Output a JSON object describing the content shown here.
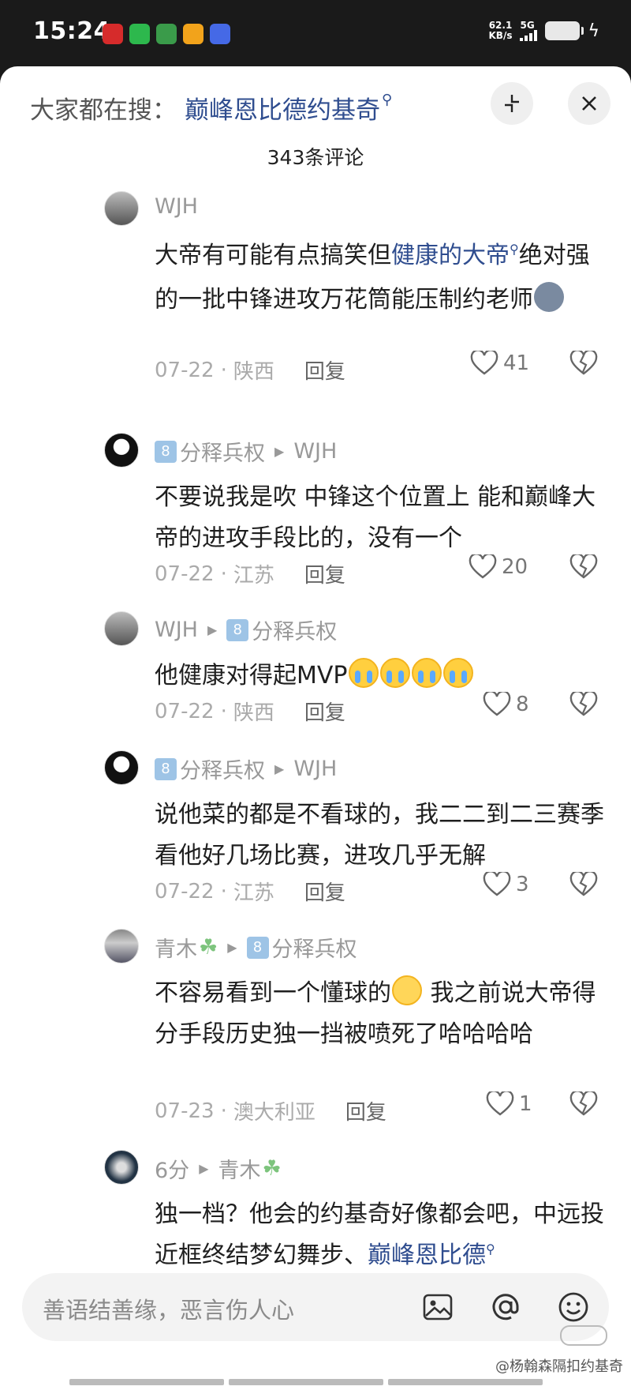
{
  "status_bar": {
    "time": "15:24",
    "net_speed_value": "62.1",
    "net_speed_unit": "KB/s",
    "network": "5G",
    "apps": [
      "app-icon-red",
      "wechat-icon",
      "video-icon",
      "orange-app-icon",
      "vivo-icon"
    ]
  },
  "header": {
    "search_prefix": "大家都在搜：",
    "search_keyword": "巅峰恩比德约基奇",
    "comment_count": "343条评论"
  },
  "comments": [
    {
      "user": "WJH",
      "text_pre": "大帝有可能有点搞笑但",
      "link": "健康的大帝",
      "text_post": "绝对强的一批中锋进攻万花筒能压制约老师",
      "date": "07-22",
      "region": "陕西",
      "reply": "回复",
      "likes": "41"
    },
    {
      "badge": "8",
      "user": "分释兵权",
      "reply_to": "WJH",
      "text": "不要说我是吹 中锋这个位置上 能和巅峰大帝的进攻手段比的，没有一个",
      "date": "07-22",
      "region": "江苏",
      "reply": "回复",
      "likes": "20"
    },
    {
      "user": "WJH",
      "reply_badge": "8",
      "reply_to": "分释兵权",
      "text": "他健康对得起MVP",
      "date": "07-22",
      "region": "陕西",
      "reply": "回复",
      "likes": "8"
    },
    {
      "badge": "8",
      "user": "分释兵权",
      "reply_to": "WJH",
      "text": "说他菜的都是不看球的，我二二到二三赛季看他好几场比赛，进攻几乎无解",
      "date": "07-22",
      "region": "江苏",
      "reply": "回复",
      "likes": "3"
    },
    {
      "user": "青木",
      "reply_badge": "8",
      "reply_to": "分释兵权",
      "text_pre": "不容易看到一个懂球的",
      "text_post": " 我之前说大帝得分手段历史独一挡被喷死了哈哈哈哈",
      "date": "07-23",
      "region": "澳大利亚",
      "reply": "回复",
      "likes": "1"
    },
    {
      "user": "6分",
      "reply_to": "青木",
      "text_pre": "独一档？他会的约基奇好像都会吧，中远投近框终结梦幻舞步、",
      "link": "巅峰恩比德"
    }
  ],
  "input": {
    "placeholder": "善语结善缘，恶言伤人心"
  },
  "watermark": "@杨翰森隔扣约基奇"
}
